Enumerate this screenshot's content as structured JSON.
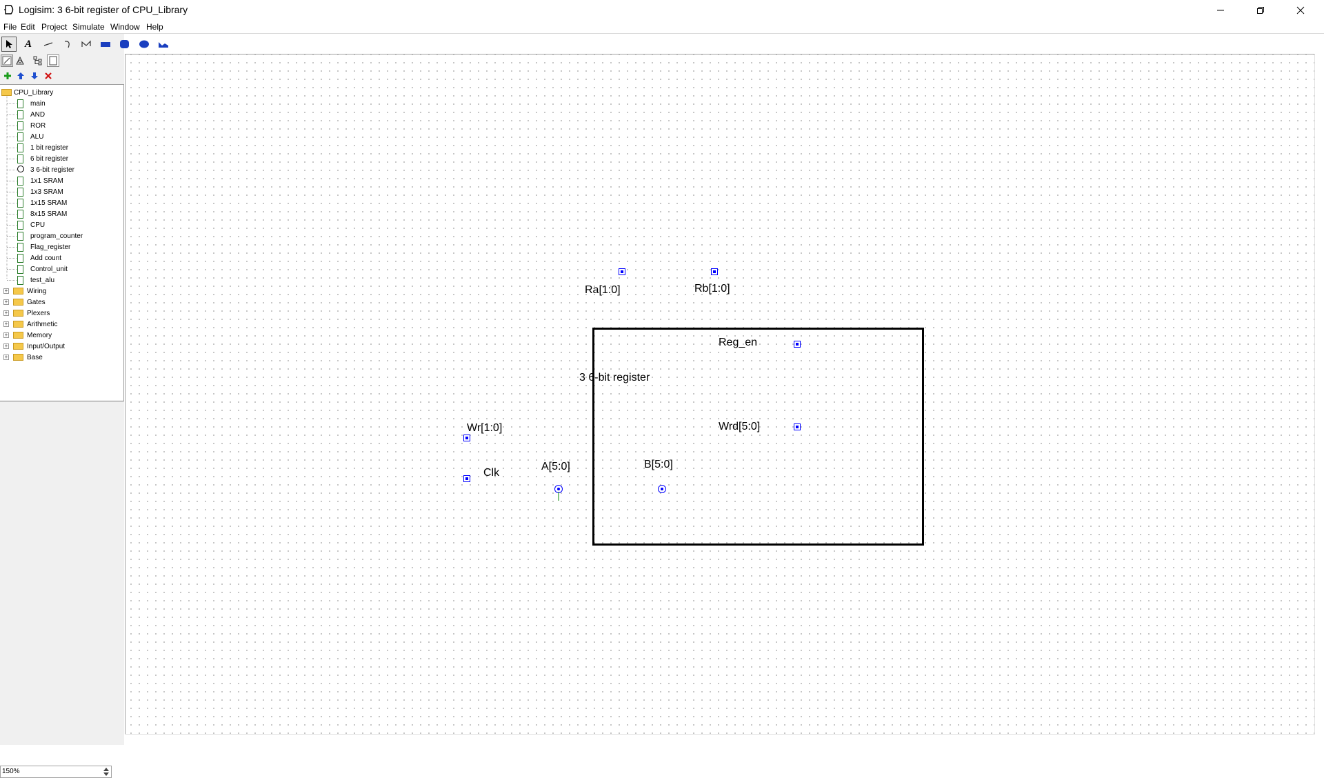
{
  "window": {
    "title": "Logisim: 3 6-bit register of CPU_Library"
  },
  "menu": [
    "File",
    "Edit",
    "Project",
    "Simulate",
    "Window",
    "Help"
  ],
  "toolbar": {
    "tools": [
      "select-tool",
      "text-tool",
      "line-tool",
      "curve-tool",
      "polyline-tool",
      "rectangle-tool",
      "rounded-rectangle-tool",
      "oval-tool",
      "polygon-tool"
    ],
    "text_tool_glyph": "A"
  },
  "explorer": {
    "project": "CPU_Library",
    "circuits": [
      "main",
      "AND",
      "ROR",
      "ALU",
      "1 bit register",
      "6 bit register",
      "3 6-bit register",
      "1x1 SRAM",
      "1x3 SRAM",
      "1x15 SRAM",
      "8x15 SRAM",
      "CPU",
      "program_counter",
      "Flag_register",
      "Add count",
      "Control_unit",
      "test_alu"
    ],
    "libraries": [
      "Wiring",
      "Gates",
      "Plexers",
      "Arithmetic",
      "Memory",
      "Input/Output",
      "Base"
    ],
    "selected": "3 6-bit register"
  },
  "zoom": "150%",
  "component": {
    "name": "3 6-bit register",
    "pins": {
      "ra": "Ra[1:0]",
      "rb": "Rb[1:0]",
      "reg_en": "Reg_en",
      "wr": "Wr[1:0]",
      "wrd": "Wrd[5:0]",
      "clk": "Clk",
      "a": "A[5:0]",
      "b": "B[5:0]"
    }
  },
  "colors": {
    "port": "#0000ff",
    "circuit_icon": "#2b7d2b",
    "folder": "#f5c84a",
    "add_icon": "#1a9c1a",
    "arrow_icon": "#1f4fcf",
    "delete_icon": "#d01010"
  }
}
